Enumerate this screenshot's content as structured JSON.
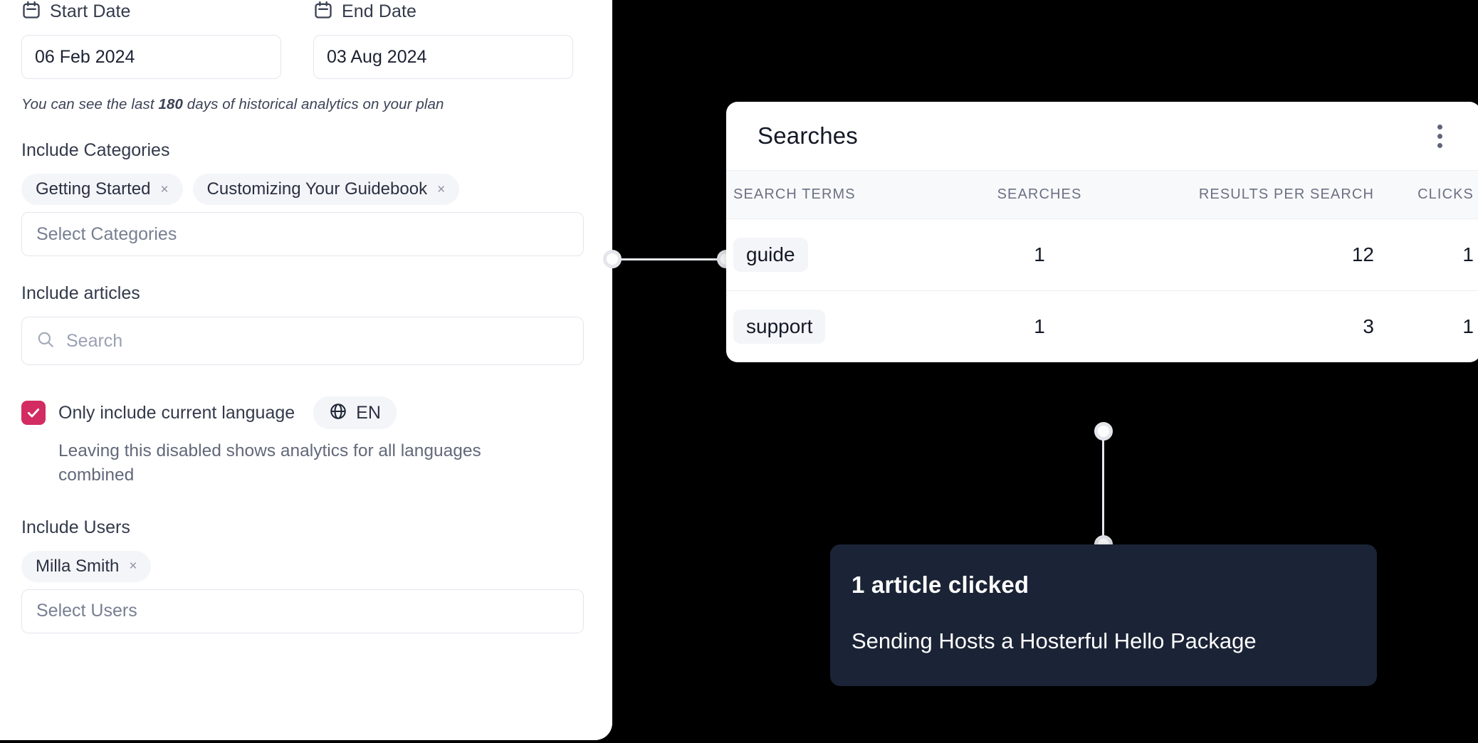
{
  "filters": {
    "start_date": {
      "icon": "calendar-icon",
      "label": "Start Date",
      "value": "06 Feb 2024"
    },
    "end_date": {
      "icon": "calendar-icon",
      "label": "End Date",
      "value": "03 Aug 2024"
    },
    "history_note": {
      "prefix": "You can see the last ",
      "days": "180",
      "suffix": " days of historical analytics on your plan"
    },
    "categories": {
      "label": "Include Categories",
      "chips": [
        "Getting Started",
        "Customizing Your Guidebook"
      ],
      "chip_remove_glyph": "×",
      "placeholder": "Select Categories"
    },
    "articles": {
      "label": "Include articles",
      "search_placeholder": "Search",
      "search_icon": "search-icon"
    },
    "language": {
      "checkbox_checked": true,
      "label": "Only include current language",
      "badge_icon": "globe-icon",
      "badge_code": "EN",
      "help_text": "Leaving this disabled shows analytics for all languages combined"
    },
    "users": {
      "label": "Include Users",
      "chips": [
        "Milla Smith"
      ],
      "chip_remove_glyph": "×",
      "placeholder": "Select Users"
    }
  },
  "searches_card": {
    "title": "Searches",
    "menu_icon": "kebab-menu-icon",
    "columns": [
      "SEARCH TERMS",
      "SEARCHES",
      "RESULTS PER SEARCH",
      "CLICKS"
    ],
    "rows": [
      {
        "term": "guide",
        "searches": "1",
        "results_per_search": "12",
        "clicks": "1"
      },
      {
        "term": "support",
        "searches": "1",
        "results_per_search": "3",
        "clicks": "1"
      }
    ]
  },
  "tooltip": {
    "title": "1 article clicked",
    "body": "Sending Hosts a Hosterful Hello Package"
  },
  "colors": {
    "accent_pink": "#d22c63",
    "clicks_pink": "#e62a6b",
    "tooltip_bg": "#1b2336",
    "connector": "#e4e6ec"
  }
}
